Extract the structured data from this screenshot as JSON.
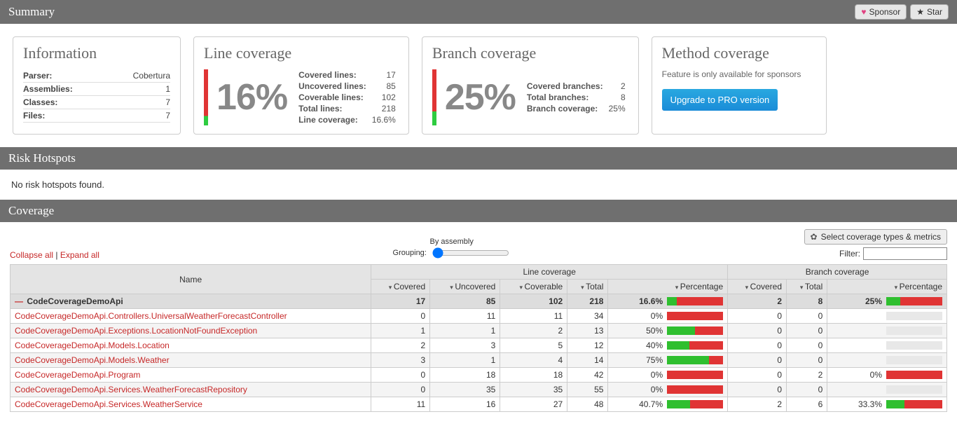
{
  "header": {
    "summary": "Summary",
    "sponsor": "Sponsor",
    "star": "Star"
  },
  "information": {
    "title": "Information",
    "rows": [
      {
        "label": "Parser:",
        "value": "Cobertura"
      },
      {
        "label": "Assemblies:",
        "value": "1"
      },
      {
        "label": "Classes:",
        "value": "7"
      },
      {
        "label": "Files:",
        "value": "7"
      }
    ]
  },
  "line_coverage": {
    "title": "Line coverage",
    "big": "16%",
    "rows": [
      {
        "label": "Covered lines:",
        "value": "17"
      },
      {
        "label": "Uncovered lines:",
        "value": "85"
      },
      {
        "label": "Coverable lines:",
        "value": "102"
      },
      {
        "label": "Total lines:",
        "value": "218"
      },
      {
        "label": "Line coverage:",
        "value": "16.6%"
      }
    ],
    "pct": 16.6
  },
  "branch_coverage": {
    "title": "Branch coverage",
    "big": "25%",
    "rows": [
      {
        "label": "Covered branches:",
        "value": "2"
      },
      {
        "label": "Total branches:",
        "value": "8"
      },
      {
        "label": "Branch coverage:",
        "value": "25%"
      }
    ],
    "pct": 25
  },
  "method_coverage": {
    "title": "Method coverage",
    "msg": "Feature is only available for sponsors",
    "button": "Upgrade to PRO version"
  },
  "risk": {
    "title": "Risk Hotspots",
    "msg": "No risk hotspots found."
  },
  "coverage_section": {
    "title": "Coverage",
    "collapse": "Collapse all",
    "expand": "Expand all",
    "grouping_label": "Grouping:",
    "grouping_hint": "By assembly",
    "filter_label": "Filter:",
    "metrics_button": "Select coverage types & metrics",
    "group_headers": {
      "line": "Line coverage",
      "branch": "Branch coverage"
    },
    "columns": {
      "name": "Name",
      "covered": "Covered",
      "uncovered": "Uncovered",
      "coverable": "Coverable",
      "total": "Total",
      "percentage": "Percentage",
      "bcovered": "Covered",
      "btotal": "Total",
      "bpercentage": "Percentage"
    }
  },
  "assembly": {
    "name": "CodeCoverageDemoApi",
    "covered": "17",
    "uncovered": "85",
    "coverable": "102",
    "total": "218",
    "pct": "16.6%",
    "pct_num": 16.6,
    "bcovered": "2",
    "btotal": "8",
    "bpct": "25%",
    "bpct_num": 25
  },
  "classes": [
    {
      "name": "CodeCoverageDemoApi.Controllers.UniversalWeatherForecastController",
      "covered": "0",
      "uncovered": "11",
      "coverable": "11",
      "total": "34",
      "pct": "0%",
      "pct_num": 0,
      "bcovered": "0",
      "btotal": "0",
      "bpct": "",
      "bpct_num": null
    },
    {
      "name": "CodeCoverageDemoApi.Exceptions.LocationNotFoundException",
      "covered": "1",
      "uncovered": "1",
      "coverable": "2",
      "total": "13",
      "pct": "50%",
      "pct_num": 50,
      "bcovered": "0",
      "btotal": "0",
      "bpct": "",
      "bpct_num": null
    },
    {
      "name": "CodeCoverageDemoApi.Models.Location",
      "covered": "2",
      "uncovered": "3",
      "coverable": "5",
      "total": "12",
      "pct": "40%",
      "pct_num": 40,
      "bcovered": "0",
      "btotal": "0",
      "bpct": "",
      "bpct_num": null
    },
    {
      "name": "CodeCoverageDemoApi.Models.Weather",
      "covered": "3",
      "uncovered": "1",
      "coverable": "4",
      "total": "14",
      "pct": "75%",
      "pct_num": 75,
      "bcovered": "0",
      "btotal": "0",
      "bpct": "",
      "bpct_num": null
    },
    {
      "name": "CodeCoverageDemoApi.Program",
      "covered": "0",
      "uncovered": "18",
      "coverable": "18",
      "total": "42",
      "pct": "0%",
      "pct_num": 0,
      "bcovered": "0",
      "btotal": "2",
      "bpct": "0%",
      "bpct_num": 0
    },
    {
      "name": "CodeCoverageDemoApi.Services.WeatherForecastRepository",
      "covered": "0",
      "uncovered": "35",
      "coverable": "35",
      "total": "55",
      "pct": "0%",
      "pct_num": 0,
      "bcovered": "0",
      "btotal": "0",
      "bpct": "",
      "bpct_num": null
    },
    {
      "name": "CodeCoverageDemoApi.Services.WeatherService",
      "covered": "11",
      "uncovered": "16",
      "coverable": "27",
      "total": "48",
      "pct": "40.7%",
      "pct_num": 40.7,
      "bcovered": "2",
      "btotal": "6",
      "bpct": "33.3%",
      "bpct_num": 33.3
    }
  ]
}
